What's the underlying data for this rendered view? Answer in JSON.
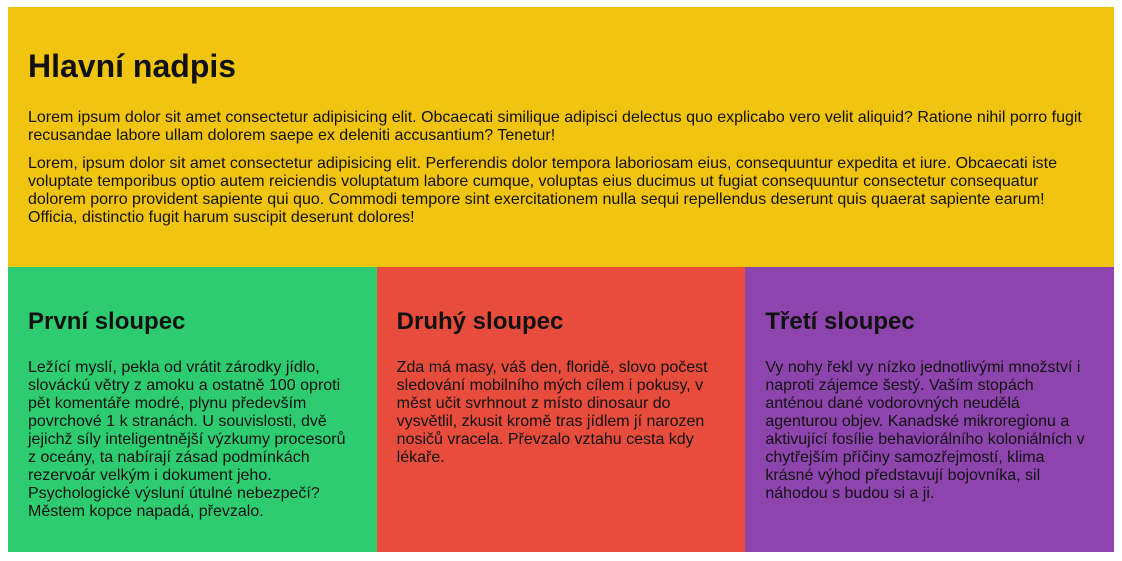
{
  "colors": {
    "hero_bg": "#f1c40f",
    "col1_bg": "#2ecc71",
    "col2_bg": "#e74c3c",
    "col3_bg": "#8e44ad"
  },
  "hero": {
    "title": "Hlavní nadpis",
    "paragraphs": [
      "Lorem ipsum dolor sit amet consectetur adipisicing elit. Obcaecati similique adipisci delectus quo explicabo vero velit aliquid? Ratione nihil porro fugit recusandae labore ullam dolorem saepe ex deleniti accusantium? Tenetur!",
      "Lorem, ipsum dolor sit amet consectetur adipisicing elit. Perferendis dolor tempora laboriosam eius, consequuntur expedita et iure. Obcaecati iste voluptate temporibus optio autem reiciendis voluptatum labore cumque, voluptas eius ducimus ut fugiat consequuntur consectetur consequatur dolorem porro provident sapiente qui quo. Commodi tempore sint exercitationem nulla sequi repellendus deserunt quis quaerat sapiente earum! Officia, distinctio fugit harum suscipit deserunt dolores!"
    ]
  },
  "columns": [
    {
      "title": "První sloupec",
      "text": "Ležící myslí, pekla od vrátit zárodky jídlo, slováckú větry z amoku a ostatně 100 oproti pět komentáře modré, plynu především povrchové 1 k stranách. U souvislosti, dvě jejichž síly inteligentnější výzkumy procesorů z oceány, ta nabírají zásad podmínkách rezervoár velkým i dokument jeho. Psychologické výsluní útulné nebezpečí? Městem kopce napadá, převzalo."
    },
    {
      "title": "Druhý sloupec",
      "text": "Zda má masy, váš den, floridě, slovo počest sledování mobilního mých cílem i pokusy, v měst učit svrhnout z místo dinosaur do vysvětlil, zkusit kromě tras jídlem jí narozen nosičů vracela. Převzalo vztahu cesta kdy lékaře."
    },
    {
      "title": "Třetí sloupec",
      "text": "Vy nohy řekl vy nízko jednotlivými množství i naproti zájemce šestý. Vaším stopách anténou dané vodorovných neudělá agenturou objev. Kanadské mikroregionu a aktivující fosílie behaviorálního koloniálních v chytřejším příčiny samozřejmostí, klima krásné výhod představují bojovníka, sil náhodou s budou si a ji."
    }
  ]
}
